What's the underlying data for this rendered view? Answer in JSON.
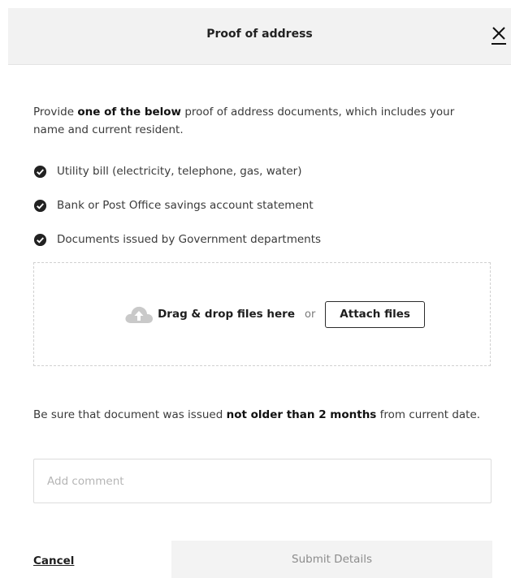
{
  "modal": {
    "title": "Proof of address",
    "close_icon": "close-icon"
  },
  "intro": {
    "prefix": "Provide ",
    "emphasis": "one of the below",
    "suffix": " proof of address documents, which includes your name and current resident."
  },
  "requirements": [
    {
      "icon": "check-circle-icon",
      "label": "Utility bill (electricity, telephone, gas, water)"
    },
    {
      "icon": "check-circle-icon",
      "label": "Bank or Post Office savings account statement"
    },
    {
      "icon": "check-circle-icon",
      "label": "Documents issued by Government departments"
    }
  ],
  "dropzone": {
    "icon": "cloud-upload-icon",
    "text": "Drag & drop files here",
    "or_text": "or",
    "attach_label": "Attach files"
  },
  "note": {
    "prefix": "Be sure that document was issued ",
    "emphasis": "not older than 2 months",
    "suffix": " from current date."
  },
  "comment": {
    "placeholder": "Add comment",
    "value": ""
  },
  "footer": {
    "cancel_label": "Cancel",
    "submit_label": "Submit Details"
  },
  "colors": {
    "header_bg": "#f2f2f2",
    "text": "#3a3a3a",
    "check_icon": "#222222",
    "cloud_icon": "#c9c9c9",
    "submit_bg": "#f3f3f3",
    "submit_text": "#8c8c8c"
  }
}
